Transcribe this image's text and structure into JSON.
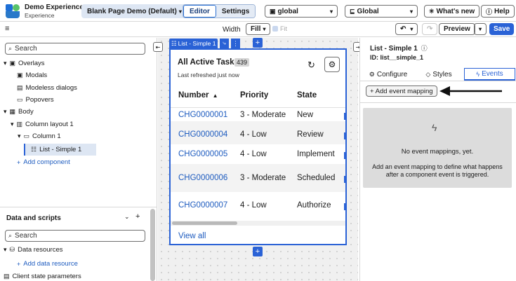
{
  "header": {
    "app_title": "Demo Experience",
    "app_subtitle": "Experience",
    "page_select": "Blank Page Demo (Default)",
    "mode_editor": "Editor",
    "mode_settings": "Settings",
    "scope_select": "global",
    "global_select": "Global",
    "whats_new": "What's new",
    "help": "Help"
  },
  "toolbar": {
    "width_label": "Width",
    "width_value": "Fill",
    "fit_label": "Fit",
    "preview": "Preview",
    "save": "Save"
  },
  "left": {
    "search_placeholder": "Search",
    "tree": [
      {
        "label": "Overlays"
      },
      {
        "label": "Modals"
      },
      {
        "label": "Modeless dialogs"
      },
      {
        "label": "Popovers"
      },
      {
        "label": "Body"
      },
      {
        "label": "Column layout 1"
      },
      {
        "label": "Column 1"
      },
      {
        "label": "List - Simple 1"
      },
      {
        "label": "Add component"
      }
    ],
    "data_title": "Data and scripts",
    "data_search_placeholder": "Search",
    "data_resources": "Data resources",
    "add_data_resource": "Add data resource",
    "client_state": "Client state parameters"
  },
  "canvas": {
    "component_tag": "List - Simple 1",
    "list_title": "All Active Tasks",
    "list_count": "439",
    "refreshed": "Last refreshed just now",
    "columns": [
      "Number",
      "Priority",
      "State"
    ],
    "rows": [
      {
        "number": "CHG0000001",
        "priority": "3 - Moderate",
        "state": "New"
      },
      {
        "number": "CHG0000004",
        "priority": "4 - Low",
        "state": "Review"
      },
      {
        "number": "CHG0000005",
        "priority": "4 - Low",
        "state": "Implement"
      },
      {
        "number": "CHG0000006",
        "priority": "3 - Moderate",
        "state": "Scheduled"
      },
      {
        "number": "CHG0000007",
        "priority": "4 - Low",
        "state": "Authorize"
      }
    ],
    "view_all": "View all"
  },
  "right": {
    "title": "List - Simple 1",
    "id_label": "ID: list__simple_1",
    "tabs": [
      "Configure",
      "Styles",
      "Events"
    ],
    "add_event": "+ Add event mapping",
    "empty_title": "No event mappings, yet.",
    "empty_desc": "Add an event mapping to define what happens after a component event is triggered."
  },
  "colors": {
    "accent": "#2a62d6",
    "link": "#1d5bbf",
    "save": "#2a62d6"
  }
}
